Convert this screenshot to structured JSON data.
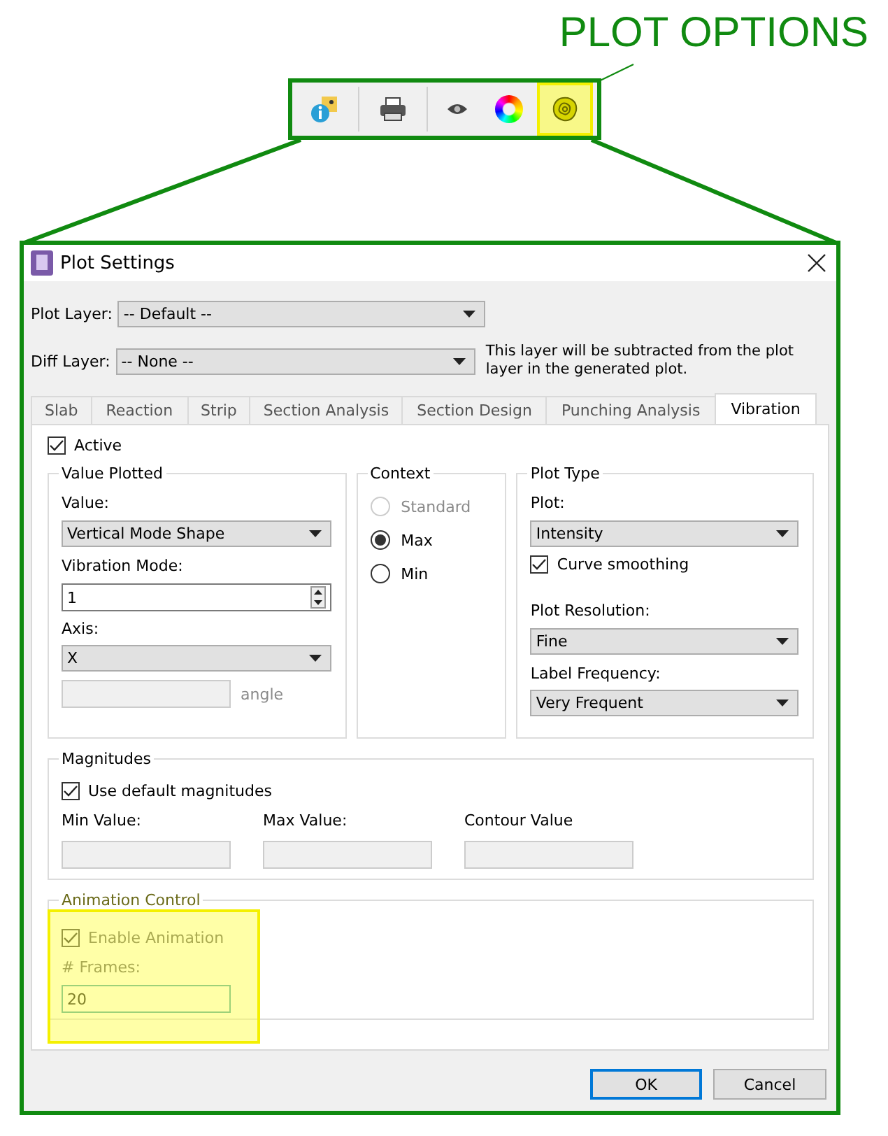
{
  "annotation": {
    "label": "PLOT OPTIONS"
  },
  "toolbar": {
    "items": [
      {
        "kind": "info-map",
        "highlighted": false,
        "separator_after": true
      },
      {
        "kind": "printer",
        "highlighted": false,
        "separator_after": true
      },
      {
        "kind": "eye",
        "highlighted": false,
        "separator_after": false
      },
      {
        "kind": "color-wheel",
        "highlighted": false,
        "separator_after": false
      },
      {
        "kind": "contour",
        "highlighted": true,
        "separator_after": false
      }
    ]
  },
  "dialog": {
    "title": "Plot Settings",
    "plot_layer": {
      "label": "Plot Layer:",
      "value": "-- Default --"
    },
    "diff_layer": {
      "label": "Diff Layer:",
      "value": "-- None --",
      "note": "This layer will be subtracted from the plot layer in the generated plot."
    },
    "tabs": [
      {
        "label": "Slab",
        "selected": false
      },
      {
        "label": "Reaction",
        "selected": false
      },
      {
        "label": "Strip",
        "selected": false
      },
      {
        "label": "Section Analysis",
        "selected": false
      },
      {
        "label": "Section Design",
        "selected": false
      },
      {
        "label": "Punching Analysis",
        "selected": false
      },
      {
        "label": "Vibration",
        "selected": true
      }
    ],
    "active": {
      "label": "Active",
      "checked": true
    },
    "value_plotted": {
      "title": "Value Plotted",
      "value_label": "Value:",
      "value": "Vertical Mode Shape",
      "mode_label": "Vibration Mode:",
      "mode": "1",
      "axis_label": "Axis:",
      "axis": "X",
      "angle_label": "angle"
    },
    "context": {
      "title": "Context",
      "options": [
        {
          "label": "Standard",
          "selected": false,
          "disabled": true
        },
        {
          "label": "Max",
          "selected": true,
          "disabled": false
        },
        {
          "label": "Min",
          "selected": false,
          "disabled": false
        }
      ]
    },
    "plot_type": {
      "title": "Plot Type",
      "plot_label": "Plot:",
      "plot": "Intensity",
      "smoothing": {
        "label": "Curve smoothing",
        "checked": true
      },
      "resolution_label": "Plot Resolution:",
      "resolution": "Fine",
      "frequency_label": "Label Frequency:",
      "frequency": "Very Frequent"
    },
    "magnitudes": {
      "title": "Magnitudes",
      "use_default": {
        "label": "Use default magnitudes",
        "checked": true
      },
      "fields": [
        "Min Value:",
        "Max Value:",
        "Contour Value"
      ]
    },
    "animation": {
      "title": "Animation Control",
      "highlighted": true,
      "enable": {
        "label": "Enable Animation",
        "checked": true
      },
      "frames_label": "# Frames:",
      "frames": "20"
    },
    "buttons": [
      {
        "label": "OK",
        "default": true
      },
      {
        "label": "Cancel",
        "default": false
      }
    ]
  }
}
